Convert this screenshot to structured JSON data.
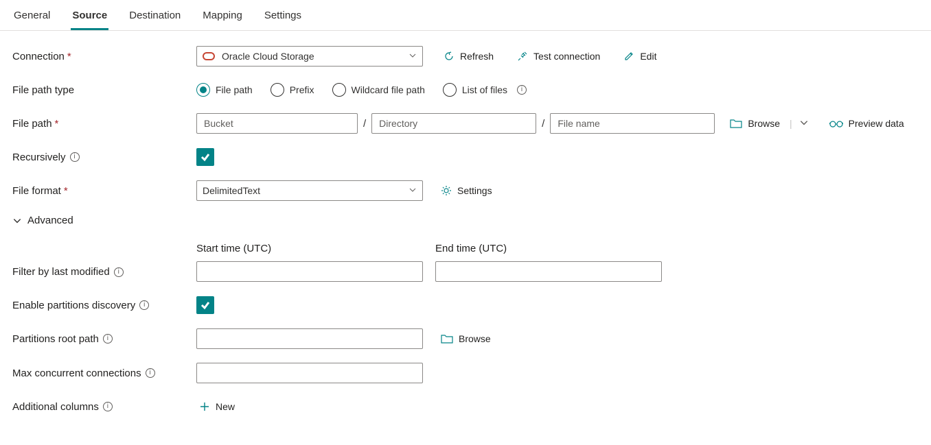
{
  "tabs": [
    "General",
    "Source",
    "Destination",
    "Mapping",
    "Settings"
  ],
  "activeTab": "Source",
  "labels": {
    "connection": "Connection",
    "filePathType": "File path type",
    "filePath": "File path",
    "recursively": "Recursively",
    "fileFormat": "File format",
    "advanced": "Advanced",
    "filterByLastModified": "Filter by last modified",
    "enablePartitionsDiscovery": "Enable partitions discovery",
    "partitionsRootPath": "Partitions root path",
    "maxConcurrentConnections": "Max concurrent connections",
    "additionalColumns": "Additional columns"
  },
  "connection": {
    "value": "Oracle Cloud Storage",
    "refresh": "Refresh",
    "testConnection": "Test connection",
    "edit": "Edit"
  },
  "filePathType": {
    "selected": "File path",
    "options": [
      "File path",
      "Prefix",
      "Wildcard file path",
      "List of files"
    ]
  },
  "filePath": {
    "bucketPlaceholder": "Bucket",
    "directoryPlaceholder": "Directory",
    "fileNamePlaceholder": "File name",
    "browse": "Browse",
    "previewData": "Preview data"
  },
  "fileFormat": {
    "value": "DelimitedText",
    "settings": "Settings"
  },
  "time": {
    "startLabel": "Start time (UTC)",
    "endLabel": "End time (UTC)"
  },
  "partitions": {
    "browse": "Browse"
  },
  "additional": {
    "new": "New"
  }
}
